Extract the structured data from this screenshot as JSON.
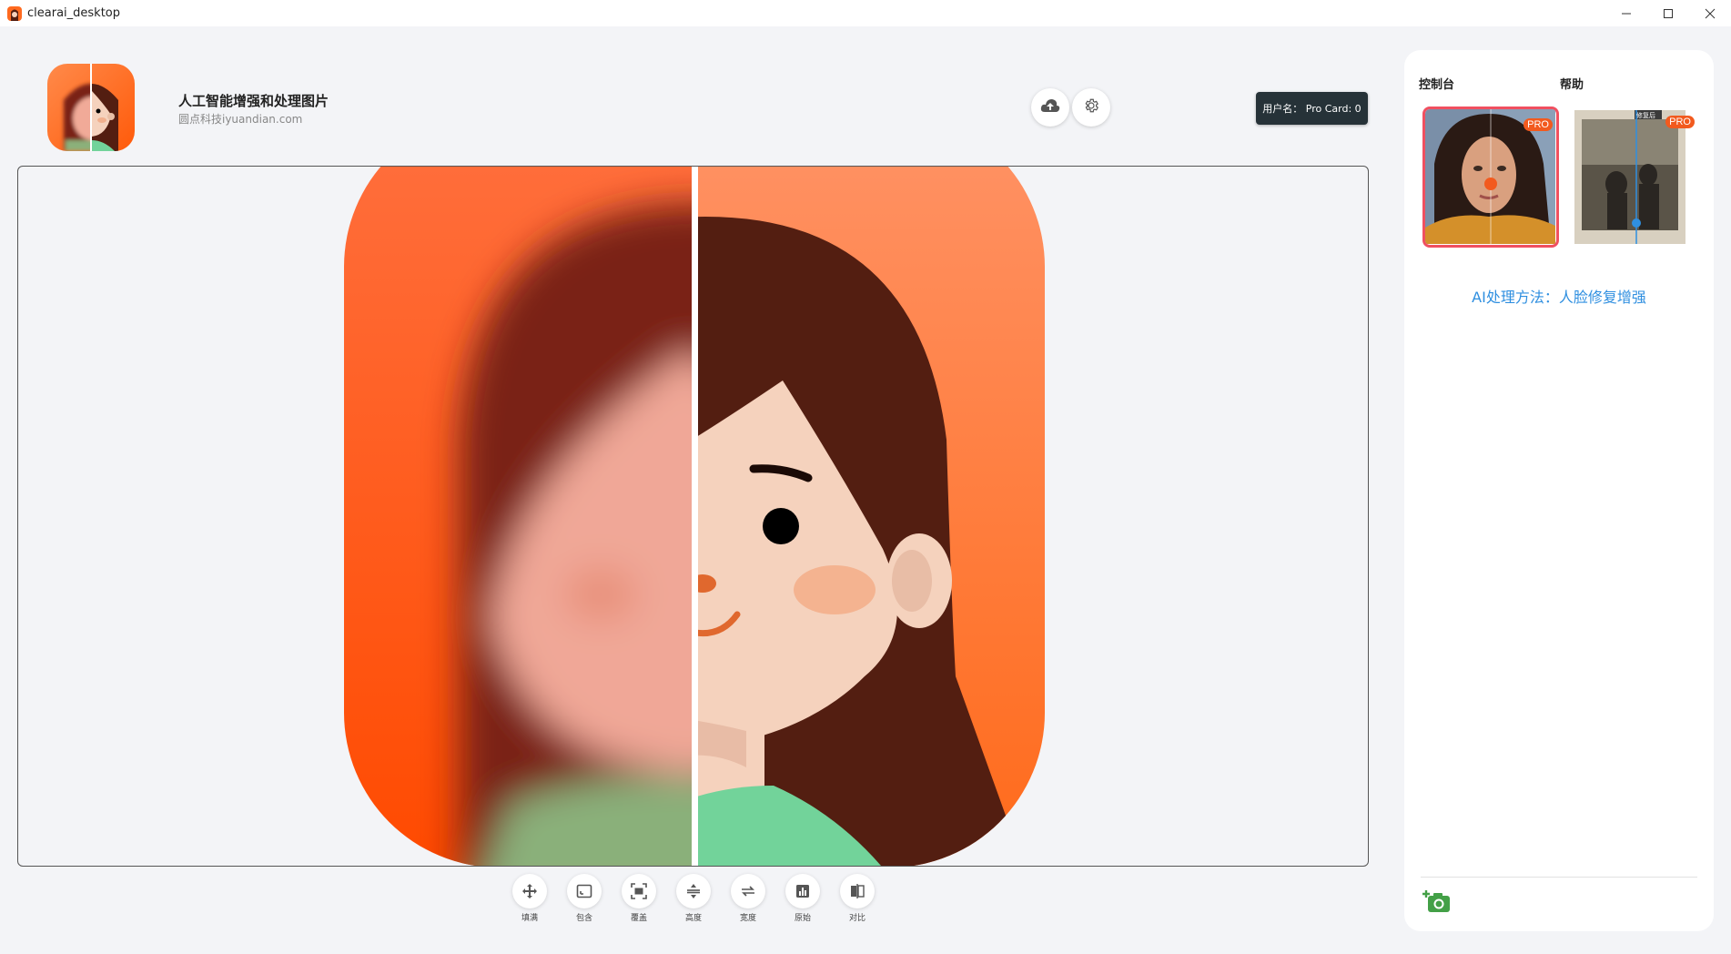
{
  "window": {
    "title": "clearai_desktop",
    "controls": [
      "minimize",
      "maximize",
      "close"
    ]
  },
  "header": {
    "title": "人工智能增强和处理图片",
    "subtitle": "圆点科技iyuandian.com",
    "user_badge": "用户名： Pro Card: 0",
    "icons": [
      "cloud-upload-icon",
      "gear-icon"
    ]
  },
  "toolbar": {
    "tools": [
      {
        "label": "填满",
        "icon": "move-icon"
      },
      {
        "label": "包含",
        "icon": "contain-icon"
      },
      {
        "label": "覆盖",
        "icon": "cover-icon"
      },
      {
        "label": "高度",
        "icon": "height-icon"
      },
      {
        "label": "宽度",
        "icon": "width-icon"
      },
      {
        "label": "原始",
        "icon": "bar-chart-icon"
      },
      {
        "label": "对比",
        "icon": "compare-icon"
      }
    ]
  },
  "panel": {
    "tabs": [
      "控制台",
      "帮助"
    ],
    "methods": [
      {
        "badge": "PRO",
        "selected": true
      },
      {
        "badge": "PRO",
        "selected": false,
        "tag": "修复后"
      }
    ],
    "ai_method_label": "AI处理方法：人脸修复增强"
  },
  "colors": {
    "accent_orange": "#f25a1e",
    "selection_red": "#f05060",
    "link_blue": "#2f8fe0",
    "badge_dark": "#263238",
    "hair_brown": "#531e11"
  }
}
